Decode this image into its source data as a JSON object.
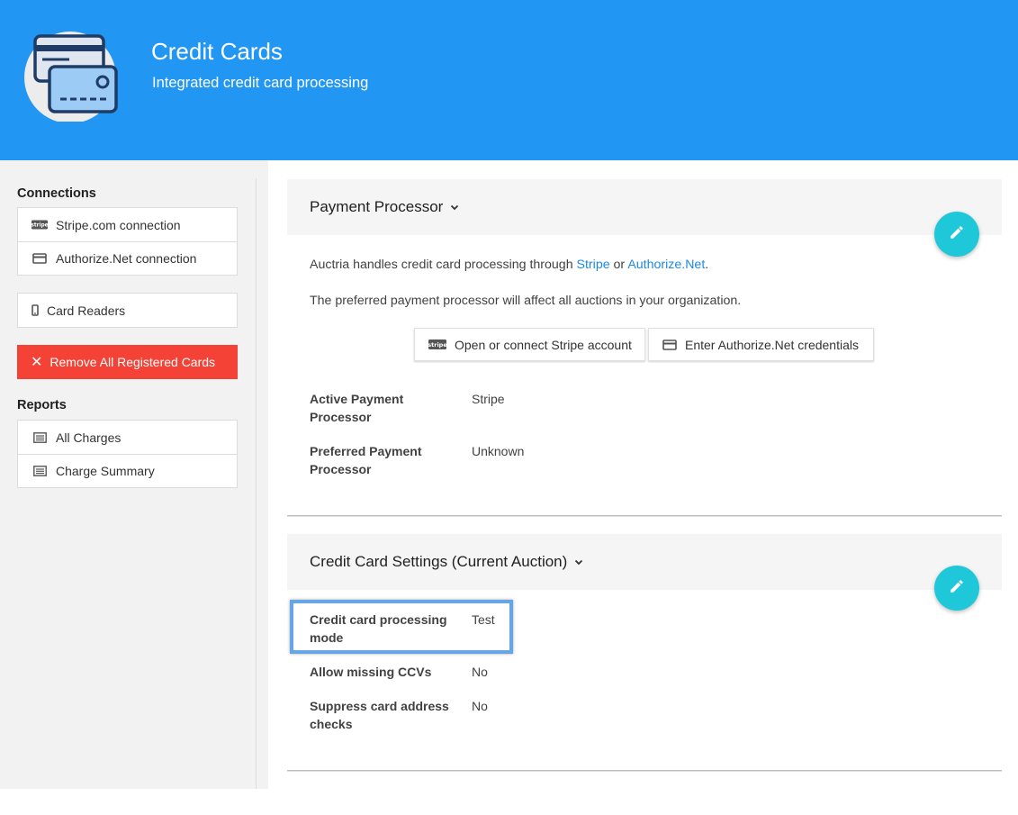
{
  "header": {
    "title": "Credit Cards",
    "subtitle": "Integrated credit card processing",
    "logo_icon": "credit-cards-icon"
  },
  "sidebar": {
    "connections_heading": "Connections",
    "connections": [
      {
        "label": "Stripe.com connection",
        "icon": "stripe-icon"
      },
      {
        "label": "Authorize.Net connection",
        "icon": "credit-card-icon"
      }
    ],
    "card_readers": {
      "label": "Card Readers",
      "icon": "phone-icon"
    },
    "remove_button": {
      "label": "Remove All Registered Cards",
      "icon": "close-icon"
    },
    "reports_heading": "Reports",
    "reports": [
      {
        "label": "All Charges",
        "icon": "list-icon"
      },
      {
        "label": "Charge Summary",
        "icon": "list-icon"
      }
    ]
  },
  "payment_processor": {
    "title": "Payment Processor",
    "intro_prefix": "Auctria handles credit card processing through ",
    "intro_link1": "Stripe",
    "intro_mid": " or ",
    "intro_link2": "Authorize.Net",
    "intro_suffix": ".",
    "note": "The preferred payment processor will affect all auctions in your organization.",
    "buttons": {
      "stripe": "Open or connect Stripe account",
      "authorize": "Enter Authorize.Net credentials"
    },
    "fields": [
      {
        "label": "Active Payment Processor",
        "value": "Stripe"
      },
      {
        "label": "Preferred Payment Processor",
        "value": "Unknown"
      }
    ]
  },
  "cc_settings": {
    "title": "Credit Card Settings (Current Auction)",
    "fields": [
      {
        "label": "Credit card processing mode",
        "value": "Test"
      },
      {
        "label": "Allow missing CCVs",
        "value": "No"
      },
      {
        "label": "Suppress card address checks",
        "value": "No"
      }
    ]
  },
  "colors": {
    "header": "#2196f3",
    "danger": "#f44336",
    "fab": "#1ec8d8",
    "link": "#1e88e5"
  }
}
